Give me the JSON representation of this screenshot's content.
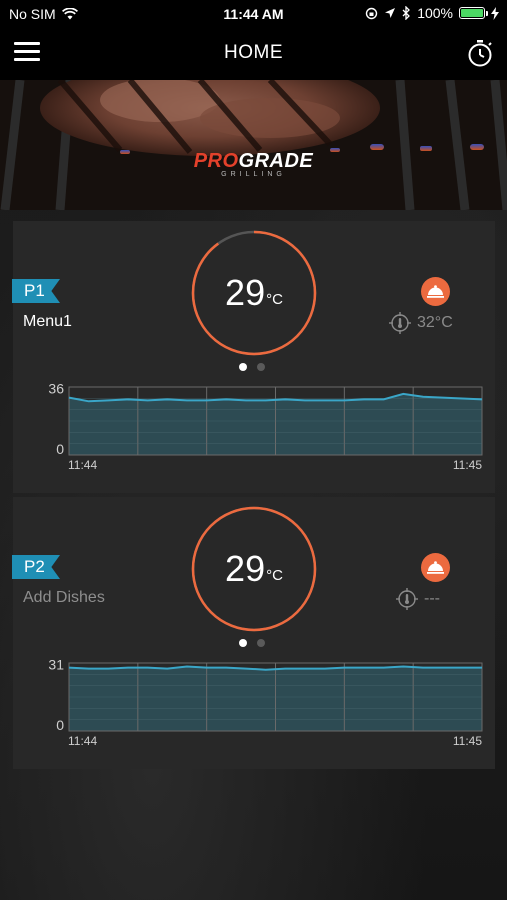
{
  "status": {
    "carrier": "No SIM",
    "time": "11:44 AM",
    "battery": "100%",
    "battery_color": "#4cd964"
  },
  "nav": {
    "title": "HOME",
    "menu_icon": "hamburger-menu-icon",
    "timer_icon": "stopwatch-icon"
  },
  "hero": {
    "brand_pro": "PRO",
    "brand_grade": "GRADE",
    "brand_sub": "GRILLING"
  },
  "accent_color": "#ec6a3f",
  "tag_color": "#1f8fb5",
  "chart_line_color": "#3aa6c8",
  "probes": [
    {
      "tag": "P1",
      "menu": "Menu1",
      "temperature": "29",
      "unit": "°C",
      "ring_progress": 0.9,
      "dish_icon": "food-cloche-icon",
      "target_icon": "thermometer-target-icon",
      "target": "32°C",
      "chart": {
        "ymax_label": "36",
        "ymin_label": "0",
        "ymax": 36,
        "x_start": "11:44",
        "x_end": "11:45",
        "values": [
          31,
          29,
          29.5,
          30,
          29.5,
          30,
          29.5,
          29.5,
          30,
          29.5,
          29.5,
          30,
          29.5,
          29.5,
          29.5,
          30,
          30,
          33,
          31.5,
          31,
          30.5,
          30
        ]
      }
    },
    {
      "tag": "P2",
      "menu": "Add Dishes",
      "temperature": "29",
      "unit": "°C",
      "ring_progress": 1.0,
      "dish_icon": "food-cloche-icon",
      "target_icon": "thermometer-target-icon",
      "target": "---",
      "chart": {
        "ymax_label": "31",
        "ymin_label": "0",
        "ymax": 31,
        "x_start": "11:44",
        "x_end": "11:45",
        "values": [
          29.5,
          29,
          29,
          29.5,
          29.5,
          29,
          30,
          29.5,
          29.5,
          29,
          28.5,
          29,
          29,
          29,
          29.5,
          29.5,
          29.5,
          30,
          29.5,
          29.5,
          29.5,
          29.5
        ]
      }
    }
  ],
  "page_dots": 2
}
